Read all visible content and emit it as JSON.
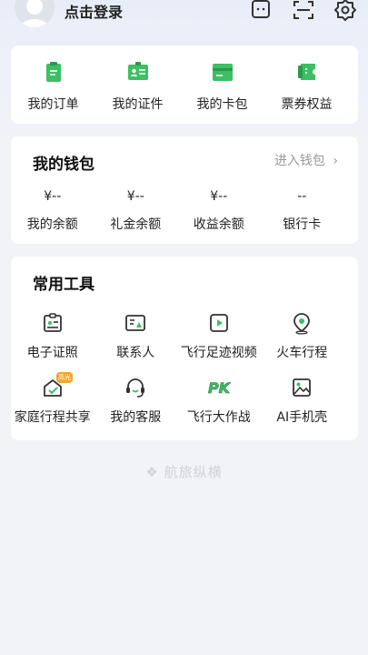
{
  "header": {
    "login_label": "点击登录",
    "icons": [
      "avatar",
      "message-icon",
      "scan-icon",
      "settings-icon"
    ]
  },
  "quick_entries": [
    {
      "label": "我的订单",
      "icon": "order-icon"
    },
    {
      "label": "我的证件",
      "icon": "id-card-icon"
    },
    {
      "label": "我的卡包",
      "icon": "wallet-card-icon"
    },
    {
      "label": "票券权益",
      "icon": "coupon-icon"
    }
  ],
  "wallet": {
    "title": "我的钱包",
    "link_label": "进入钱包",
    "items": [
      {
        "value": "¥--",
        "label": "我的余额"
      },
      {
        "value": "¥--",
        "label": "礼金余额"
      },
      {
        "value": "¥--",
        "label": "收益余额"
      },
      {
        "value": "--",
        "label": "银行卡"
      }
    ]
  },
  "tools": {
    "title": "常用工具",
    "items": [
      {
        "label": "电子证照",
        "icon": "e-license-icon"
      },
      {
        "label": "联系人",
        "icon": "contacts-icon"
      },
      {
        "label": "飞行足迹视频",
        "icon": "video-icon"
      },
      {
        "label": "火车行程",
        "icon": "location-pin-icon"
      },
      {
        "label": "家庭行程共享",
        "icon": "family-share-icon",
        "badge": "高光"
      },
      {
        "label": "我的客服",
        "icon": "headset-icon"
      },
      {
        "label": "飞行大作战",
        "icon": "pk-icon",
        "icon_text": "PK"
      },
      {
        "label": "AI手机壳",
        "icon": "image-icon"
      }
    ]
  },
  "footer": {
    "brand": "航旅纵横"
  },
  "colors": {
    "accent": "#3dbf63",
    "background": "#f2f3f7",
    "card": "#ffffff",
    "muted": "#999999"
  }
}
